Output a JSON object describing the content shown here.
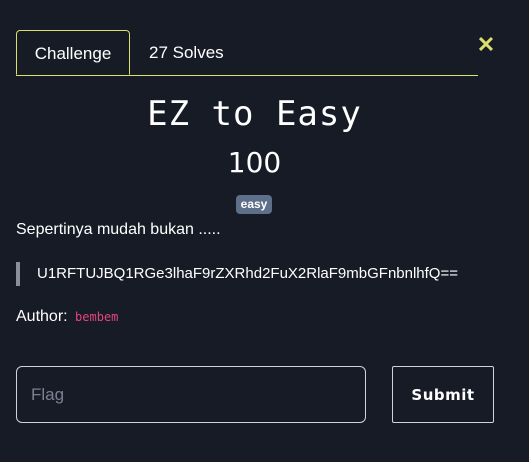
{
  "tabs": [
    {
      "label": "Challenge",
      "active": true
    },
    {
      "label": "27 Solves",
      "active": false
    }
  ],
  "close_icon": "close-icon",
  "challenge": {
    "title": "EZ to Easy",
    "points": "100",
    "tag": "easy",
    "description": "Sepertinya mudah bukan .....",
    "ciphertext": "U1RFTUJBQ1RGe3lhaF9rZXRhd2FuX2RlaF9mbGFnbnlhfQ==",
    "author_label": "Author:",
    "author_name": "bembem"
  },
  "form": {
    "flag_placeholder": "Flag",
    "flag_value": "",
    "submit_label": "Submit"
  },
  "colors": {
    "background": "#171b26",
    "accent": "#d9e06e",
    "tag_bg": "#5e6f8a",
    "author_name": "#e3447f"
  }
}
